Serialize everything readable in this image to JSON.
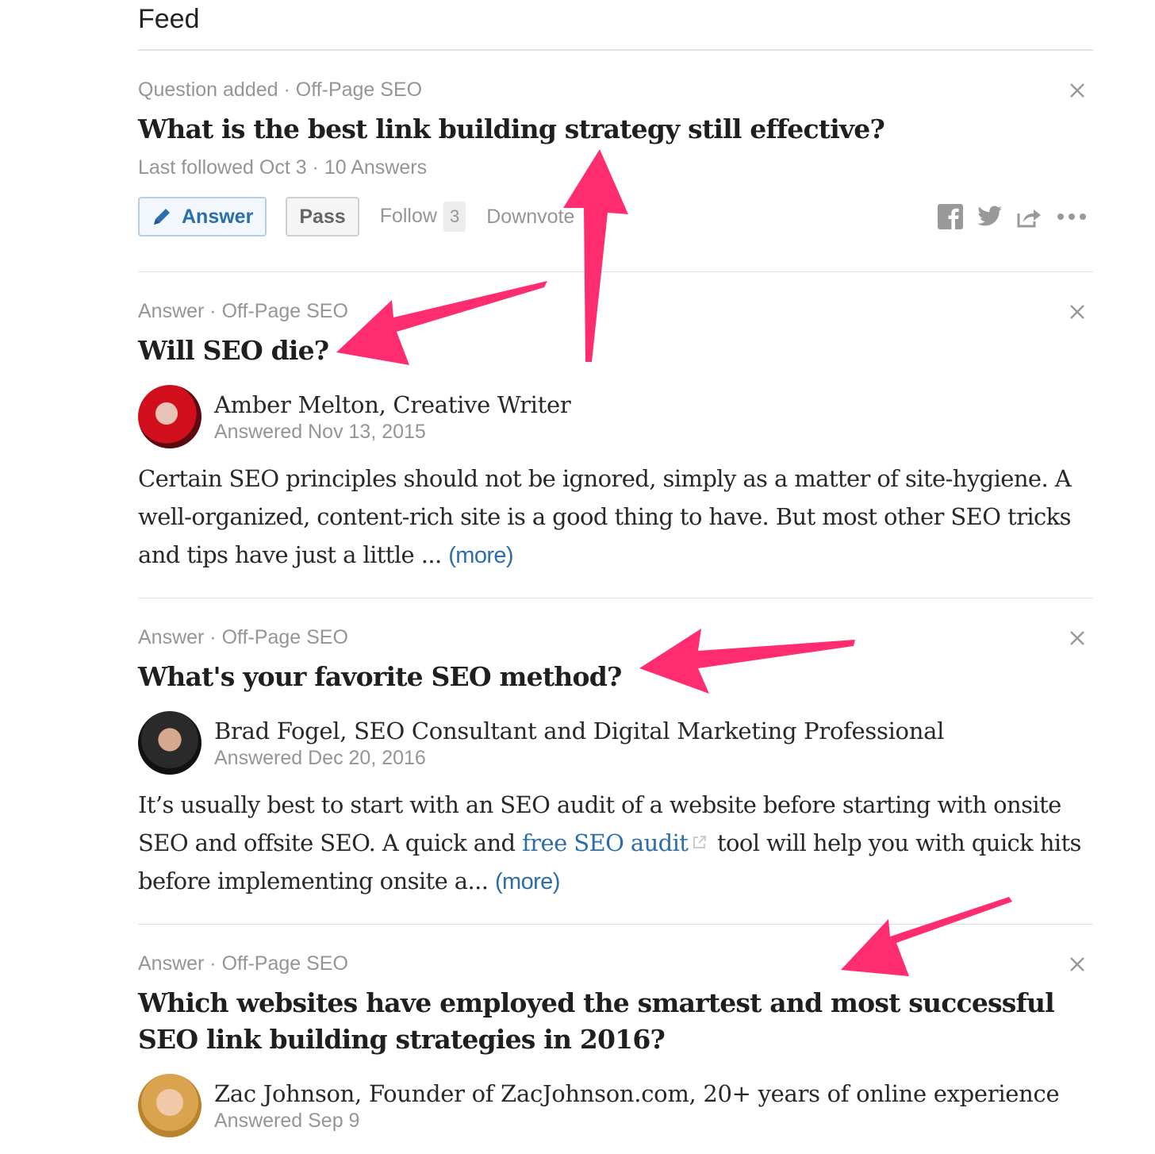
{
  "feed": {
    "title": "Feed"
  },
  "items": [
    {
      "type_label": "Question added · Off-Page SEO",
      "title": "What is the best link building strategy still effective?",
      "sub_meta": "Last followed Oct 3 · 10 Answers",
      "actions": {
        "answer_label": "Answer",
        "pass_label": "Pass",
        "follow_label": "Follow",
        "follow_count": "3",
        "downvote_label": "Downvote"
      },
      "share_icons": [
        "facebook-icon",
        "twitter-icon",
        "share-icon",
        "more-icon"
      ]
    },
    {
      "type_label": "Answer · Off-Page SEO",
      "title": "Will SEO die?",
      "author": "Amber Melton, Creative Writer",
      "answered": "Answered Nov 13, 2015",
      "body": "Certain SEO principles should not be ignored, simply as a matter of site-hygiene. A well-organized, content-rich site is a good thing to have. But most other SEO tricks and tips have just a little ... ",
      "more_label": "(more)"
    },
    {
      "type_label": "Answer · Off-Page SEO",
      "title": "What's your favorite SEO method?",
      "author": "Brad Fogel, SEO Consultant and Digital Marketing Professional",
      "answered": "Answered Dec 20, 2016",
      "body_before": "It’s usually best to start with an SEO audit of a website before starting with onsite SEO and offsite SEO. A quick and ",
      "body_link": "free SEO audit",
      "body_after": " tool will help you with quick hits before implementing onsite a... ",
      "more_label": "(more)"
    },
    {
      "type_label": "Answer · Off-Page SEO",
      "title": "Which websites have employed the smartest and most successful SEO link building strategies in 2016?",
      "author": "Zac Johnson, Founder of ZacJohnson.com, 20+ years of online experience",
      "answered": "Answered Sep 9"
    }
  ],
  "colors": {
    "accent": "#2b6dad",
    "muted": "#939598",
    "annotation_arrow": "#ff2d6f"
  }
}
